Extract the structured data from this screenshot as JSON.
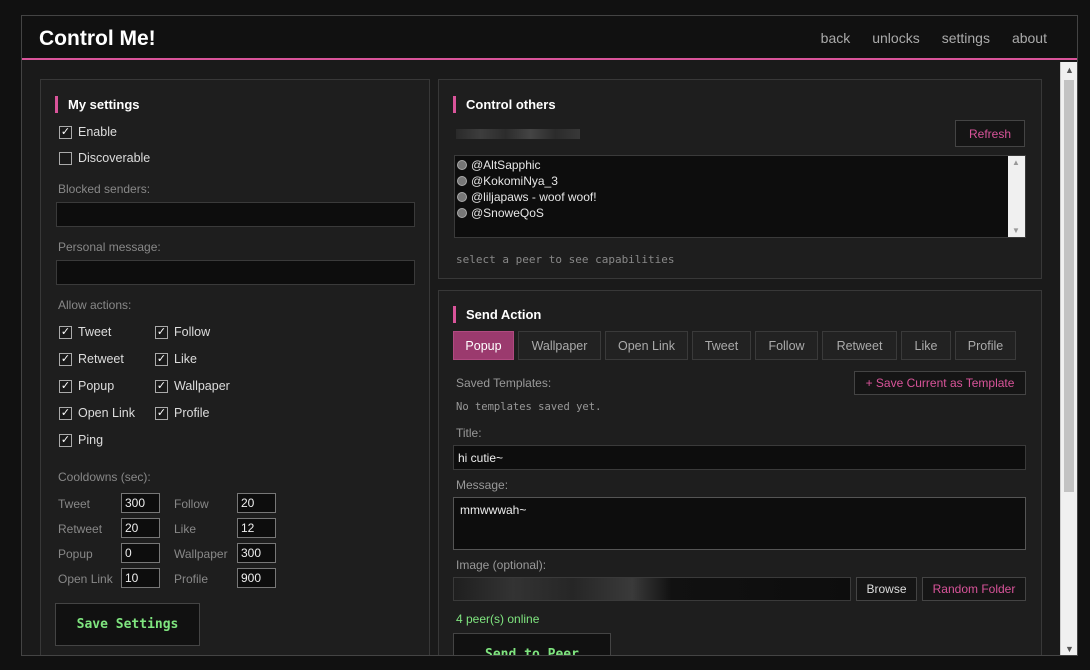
{
  "app": {
    "title": "Control Me!"
  },
  "nav": {
    "back": "back",
    "unlocks": "unlocks",
    "settings": "settings",
    "about": "about"
  },
  "my_settings": {
    "title": "My settings",
    "enable_label": "Enable",
    "enable_checked": true,
    "discoverable_label": "Discoverable",
    "discoverable_checked": false,
    "blocked_senders_label": "Blocked senders:",
    "blocked_senders_value": "",
    "personal_message_label": "Personal message:",
    "personal_message_value": "",
    "allow_actions_label": "Allow actions:",
    "actions": {
      "tweet": "Tweet",
      "follow": "Follow",
      "retweet": "Retweet",
      "like": "Like",
      "popup": "Popup",
      "wallpaper": "Wallpaper",
      "open_link": "Open Link",
      "profile": "Profile",
      "ping": "Ping"
    },
    "cooldowns_label": "Cooldowns (sec):",
    "cooldowns": {
      "tweet_label": "Tweet",
      "tweet_value": "300",
      "follow_label": "Follow",
      "follow_value": "20",
      "retweet_label": "Retweet",
      "retweet_value": "20",
      "like_label": "Like",
      "like_value": "12",
      "popup_label": "Popup",
      "popup_value": "0",
      "wallpaper_label": "Wallpaper",
      "wallpaper_value": "300",
      "open_link_label": "Open Link",
      "open_link_value": "10",
      "profile_label": "Profile",
      "profile_value": "900"
    },
    "save_button": "Save Settings"
  },
  "control_others": {
    "title": "Control others",
    "refresh_button": "Refresh",
    "peers": {
      "p1": "@AltSapphic",
      "p2": "@KokomiNya_3",
      "p3": "@liljapaws  - woof woof!",
      "p4": "@SnoweQoS"
    },
    "hint": "select a peer to see capabilities"
  },
  "send_action": {
    "title": "Send Action",
    "tabs": {
      "popup": "Popup",
      "wallpaper": "Wallpaper",
      "open_link": "Open Link",
      "tweet": "Tweet",
      "follow": "Follow",
      "retweet": "Retweet",
      "like": "Like",
      "profile": "Profile"
    },
    "active_tab": "Popup",
    "saved_templates_label": "Saved Templates:",
    "save_template_button": "+ Save Current as Template",
    "no_templates": "No templates saved yet.",
    "title_label": "Title:",
    "title_value": "hi cutie~",
    "message_label": "Message:",
    "message_value": "mmwwwah~",
    "image_label": "Image (optional):",
    "browse_button": "Browse",
    "random_folder_button": "Random Folder",
    "peers_online": "4 peer(s) online",
    "send_button": "Send to Peer"
  },
  "colors": {
    "accent": "#d9549a",
    "green": "#7fe57f",
    "tab_active": "#9b3a6e"
  }
}
